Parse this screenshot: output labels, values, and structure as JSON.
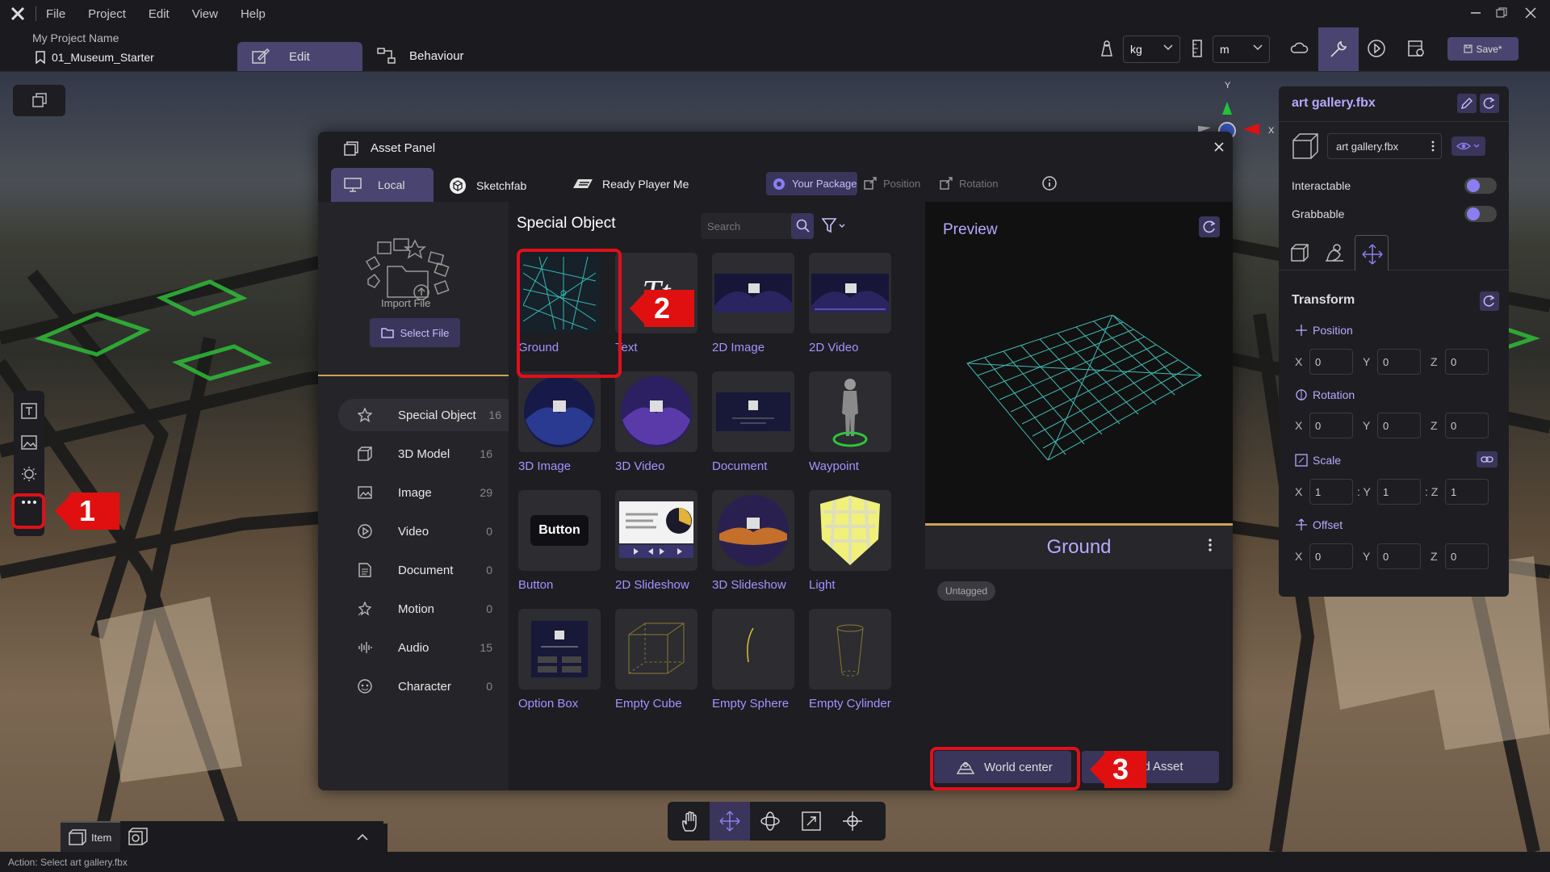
{
  "menu": [
    "File",
    "Project",
    "Edit",
    "View",
    "Help"
  ],
  "project": {
    "name": "My Project Name",
    "scene": "01_Museum_Starter"
  },
  "modes": {
    "edit": "Edit",
    "behaviour": "Behaviour"
  },
  "units": {
    "mass": "kg",
    "length": "m"
  },
  "save_label": "Save*",
  "asset_panel": {
    "title": "Asset Panel",
    "tabs": [
      "Local",
      "Sketchfab",
      "Ready Player Me"
    ],
    "your_package": "Your Package",
    "position": "Position",
    "rotation": "Rotation",
    "import_file": "Import File",
    "select_file": "Select File",
    "section_title": "Special Object",
    "search_placeholder": "Search",
    "categories": [
      {
        "label": "Special Object",
        "count": "16"
      },
      {
        "label": "3D Model",
        "count": "16"
      },
      {
        "label": "Image",
        "count": "29"
      },
      {
        "label": "Video",
        "count": "0"
      },
      {
        "label": "Document",
        "count": "0"
      },
      {
        "label": "Motion",
        "count": "0"
      },
      {
        "label": "Audio",
        "count": "15"
      },
      {
        "label": "Character",
        "count": "0"
      }
    ],
    "items": [
      "Ground",
      "Text",
      "2D Image",
      "2D Video",
      "3D Image",
      "3D Video",
      "Document",
      "Waypoint",
      "Button",
      "2D Slideshow",
      "3D Slideshow",
      "Light",
      "Option Box",
      "Empty Cube",
      "Empty Sphere",
      "Empty Cylinder"
    ],
    "button_thumb_text": "Button",
    "preview_title": "Preview",
    "selected_name": "Ground",
    "tag": "Untagged",
    "world_center": "World center",
    "add_asset": "dd Asset"
  },
  "inspector": {
    "object_name": "art gallery.fbx",
    "file_name": "art gallery.fbx",
    "interactable": "Interactable",
    "grabbable": "Grabbable",
    "transform": "Transform",
    "position": {
      "label": "Position",
      "x": "0",
      "y": "0",
      "z": "0"
    },
    "rotation": {
      "label": "Rotation",
      "x": "0",
      "y": "0",
      "z": "0"
    },
    "scale": {
      "label": "Scale",
      "x": "1",
      "y": "1",
      "z": "1"
    },
    "offset": {
      "label": "Offset",
      "x": "0",
      "y": "0",
      "z": "0"
    }
  },
  "bottom_tab": "Item",
  "status": "Action: Select art gallery.fbx",
  "gizmo": {
    "y": "Y",
    "x": "X"
  },
  "callouts": [
    "1",
    "2",
    "3"
  ],
  "colors": {
    "accent": "#8a7ef0",
    "label": "#a593ff",
    "highlight": "#e0101a",
    "panel": "#1d1d22"
  }
}
